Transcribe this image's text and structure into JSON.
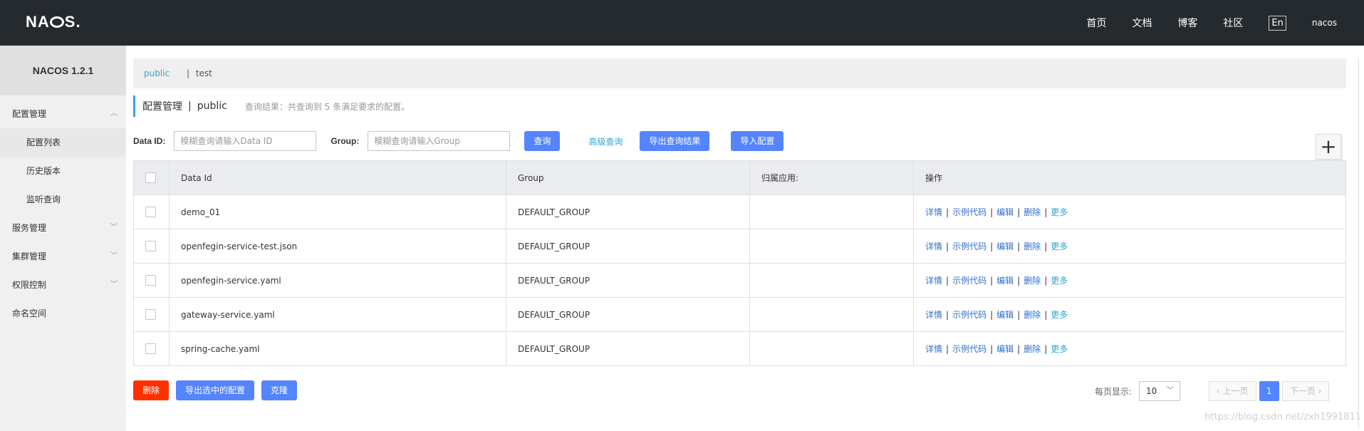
{
  "header": {
    "logo": "NACOS.",
    "nav": [
      "首页",
      "文档",
      "博客",
      "社区"
    ],
    "lang": "En",
    "user": "nacos"
  },
  "sidebar": {
    "version": "NACOS 1.2.1",
    "config_group": "配置管理",
    "config_items": [
      "配置列表",
      "历史版本",
      "监听查询"
    ],
    "service_group": "服务管理",
    "cluster_group": "集群管理",
    "auth_group": "权限控制",
    "namespace": "命名空间"
  },
  "namespaces": {
    "active": "public",
    "separator": "|",
    "other": "test"
  },
  "page": {
    "title": "配置管理",
    "separator": "|",
    "namespace": "public",
    "hint": "查询结果：共查询到 5 条满足要求的配置。"
  },
  "search": {
    "data_id_label": "Data ID:",
    "data_id_placeholder": "模糊查询请输入Data ID",
    "group_label": "Group:",
    "group_placeholder": "模糊查询请输入Group",
    "query_button": "查询",
    "advanced_link": "高级查询",
    "export_button": "导出查询结果",
    "import_button": "导入配置",
    "add_icon": "plus-icon"
  },
  "table": {
    "columns": [
      "Data Id",
      "Group",
      "归属应用:",
      "操作"
    ],
    "rows": [
      {
        "data_id": "demo_01",
        "group": "DEFAULT_GROUP",
        "app": ""
      },
      {
        "data_id": "openfegin-service-test.json",
        "group": "DEFAULT_GROUP",
        "app": ""
      },
      {
        "data_id": "openfegin-service.yaml",
        "group": "DEFAULT_GROUP",
        "app": ""
      },
      {
        "data_id": "gateway-service.yaml",
        "group": "DEFAULT_GROUP",
        "app": ""
      },
      {
        "data_id": "spring-cache.yaml",
        "group": "DEFAULT_GROUP",
        "app": ""
      }
    ],
    "ops": {
      "detail": "详情",
      "sample": "示例代码",
      "edit": "编辑",
      "delete": "删除",
      "more": "更多",
      "bar": "|"
    }
  },
  "footer": {
    "delete_button": "删除",
    "export_selected_button": "导出选中的配置",
    "clone_button": "克隆",
    "page_size_label": "每页显示:",
    "page_size": "10",
    "prev": "上一页",
    "current_page": "1",
    "next": "下一页"
  },
  "watermark": "https://blog.csdn.net/zxh1991811",
  "colors": {
    "topbar": "#252a2f",
    "primary": "#5584ff",
    "danger": "#ff3000",
    "link": "#2fa6cf"
  }
}
